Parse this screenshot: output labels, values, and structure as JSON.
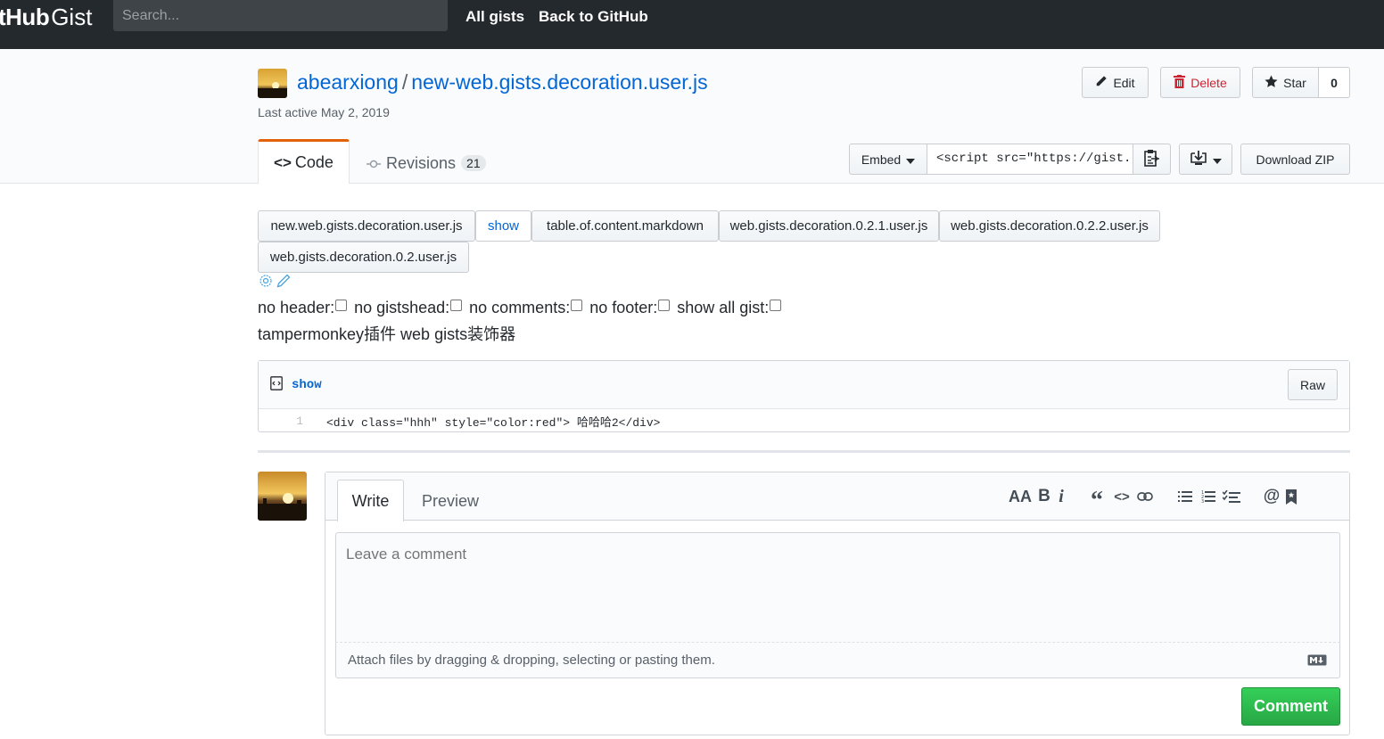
{
  "topbar": {
    "logo_hub": "tHub",
    "logo_gist": "Gist",
    "search_placeholder": "Search...",
    "nav": [
      "All gists",
      "Back to GitHub"
    ]
  },
  "gist": {
    "owner": "abearxiong",
    "separator": "/",
    "name": "new-web.gists.decoration.user.js",
    "last_active": "Last active May 2, 2019"
  },
  "actions": {
    "edit": "Edit",
    "delete": "Delete",
    "star": "Star",
    "star_count": "0",
    "embed": "Embed",
    "embed_value": "<script src=\"https://gist.",
    "download": "Download ZIP"
  },
  "tabs": {
    "code": "Code",
    "revisions": "Revisions",
    "revisions_count": "21"
  },
  "files": [
    "new.web.gists.decoration.user.js",
    "show",
    "table.of.content.markdown",
    "web.gists.decoration.0.2.1.user.js",
    "web.gists.decoration.0.2.2.user.js",
    "web.gists.decoration.0.2.user.js"
  ],
  "options": [
    "no header:",
    "no gistshead:",
    "no comments:",
    "no footer:",
    "show all gist:"
  ],
  "description": "tampermonkey插件 web gists装饰器",
  "file_view": {
    "name": "show",
    "raw": "Raw",
    "line_number": "1",
    "line_code": "<div class=\"hhh\" style=\"color:red\"> 哈哈哈2</div>"
  },
  "comment": {
    "write": "Write",
    "preview": "Preview",
    "placeholder": "Leave a comment",
    "attach": "Attach files by dragging & dropping, selecting or pasting them.",
    "submit": "Comment"
  }
}
